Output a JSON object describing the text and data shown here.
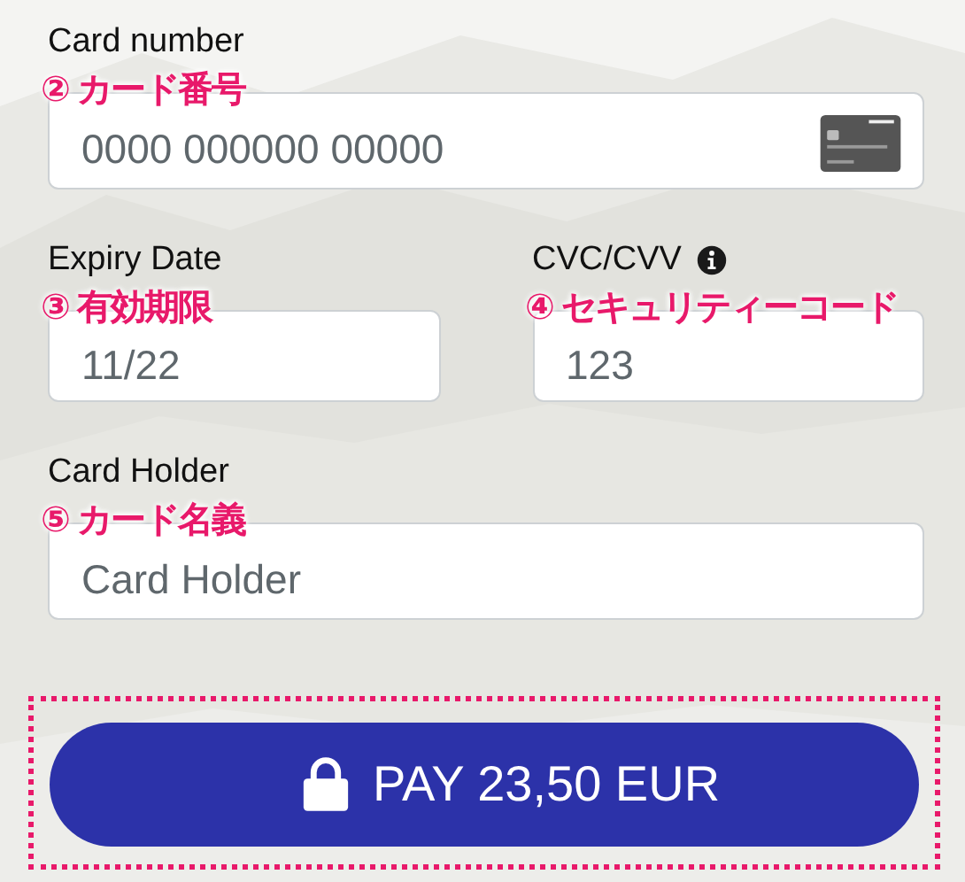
{
  "rows": [
    {
      "fields": [
        {
          "kind": "card_number",
          "label": "Card number",
          "annotation": "② カード番号",
          "placeholder": "0000 000000 00000"
        }
      ]
    },
    {
      "fields": [
        {
          "kind": "text",
          "label": "Expiry Date",
          "annotation": "③ 有効期限",
          "placeholder": "11/22"
        },
        {
          "kind": "cvc",
          "label": "CVC/CVV",
          "annotation": "④ セキュリティーコード",
          "placeholder": "123"
        }
      ]
    },
    {
      "fields": [
        {
          "kind": "text",
          "label": "Card Holder",
          "annotation": "⑤ カード名義",
          "placeholder": "Card Holder"
        }
      ]
    }
  ],
  "pay_button": {
    "label": "PAY 23,50 EUR",
    "highlighted": true
  }
}
